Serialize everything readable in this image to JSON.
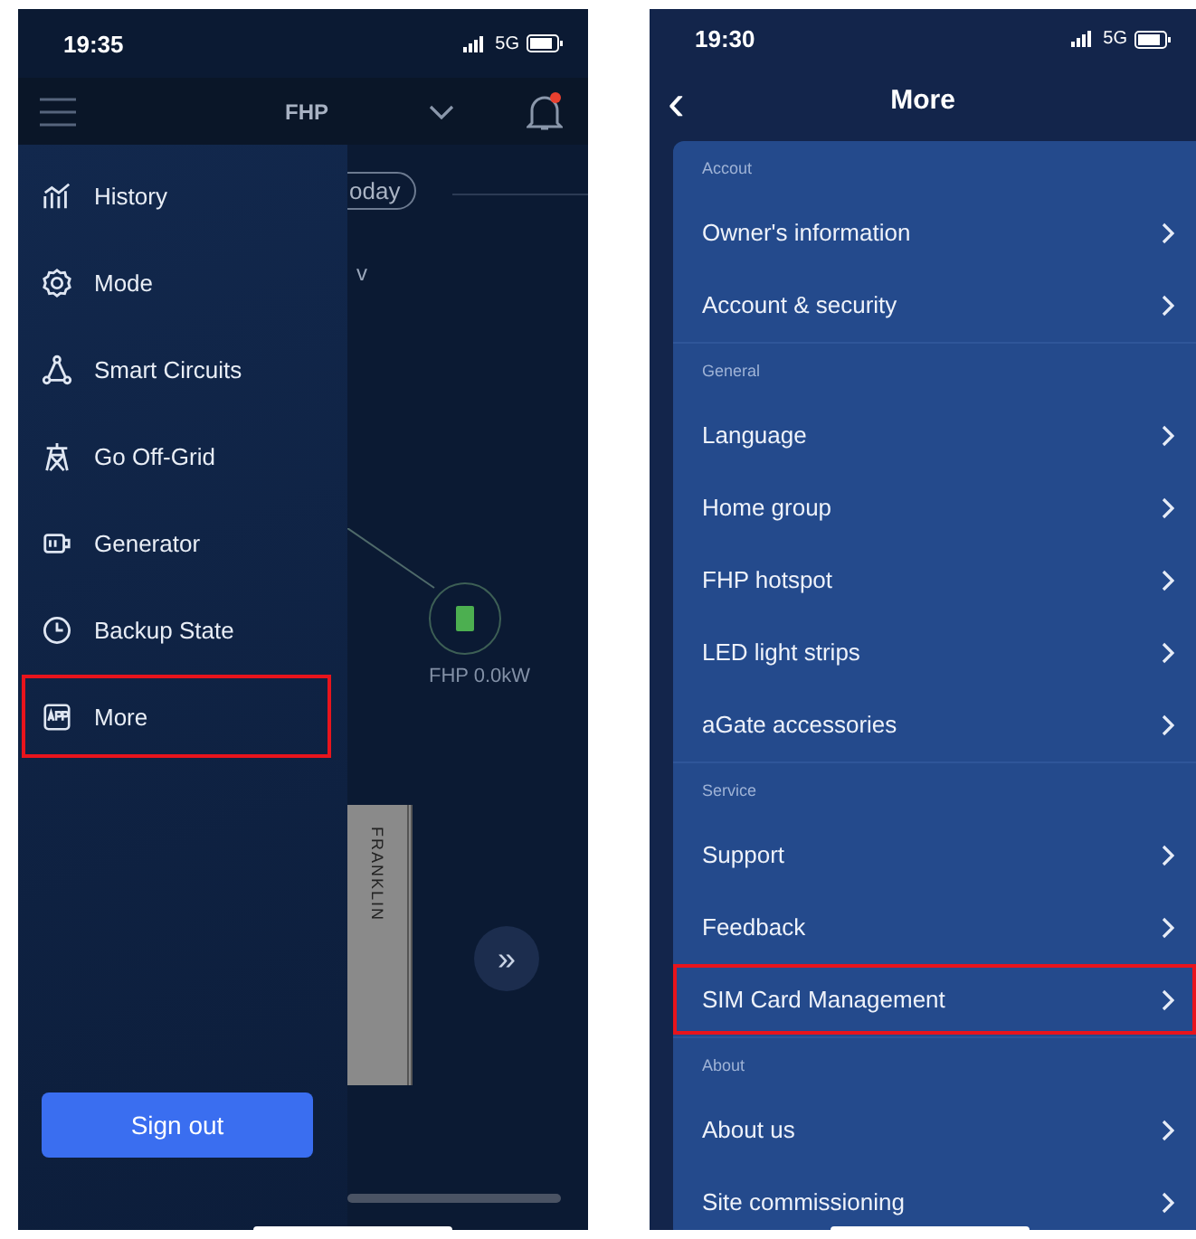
{
  "left_screen": {
    "status_bar": {
      "time": "19:35",
      "network": "5G"
    },
    "header": {
      "title": "FHP",
      "notification_dot": true
    },
    "drawer": {
      "items": [
        {
          "label": "History",
          "highlighted": false
        },
        {
          "label": "Mode",
          "highlighted": false
        },
        {
          "label": "Smart Circuits",
          "highlighted": false
        },
        {
          "label": "Go Off-Grid",
          "highlighted": false
        },
        {
          "label": "Generator",
          "highlighted": false
        },
        {
          "label": "Backup State",
          "highlighted": false
        },
        {
          "label": "More",
          "highlighted": true
        }
      ],
      "sign_out": "Sign out"
    },
    "background": {
      "period_pill": "oday",
      "fragment": "v",
      "device_label": "FHP 0.0kW",
      "battery_brand": "FRANKLIN",
      "forward_button": "»"
    }
  },
  "right_screen": {
    "status_bar": {
      "time": "19:30",
      "network": "5G"
    },
    "header": {
      "back": "‹",
      "title": "More"
    },
    "sections": [
      {
        "title": "Accout",
        "items": [
          {
            "label": "Owner's information",
            "highlighted": false
          },
          {
            "label": "Account & security",
            "highlighted": false
          }
        ]
      },
      {
        "title": "General",
        "items": [
          {
            "label": "Language",
            "highlighted": false
          },
          {
            "label": "Home group",
            "highlighted": false
          },
          {
            "label": "FHP hotspot",
            "highlighted": false
          },
          {
            "label": "LED light strips",
            "highlighted": false
          },
          {
            "label": "aGate accessories",
            "highlighted": false
          }
        ]
      },
      {
        "title": "Service",
        "items": [
          {
            "label": "Support",
            "highlighted": false
          },
          {
            "label": "Feedback",
            "highlighted": false
          },
          {
            "label": "SIM Card Management",
            "highlighted": true
          }
        ]
      },
      {
        "title": "About",
        "items": [
          {
            "label": "About us",
            "highlighted": false
          },
          {
            "label": "Site commissioning",
            "highlighted": false
          }
        ]
      }
    ]
  }
}
